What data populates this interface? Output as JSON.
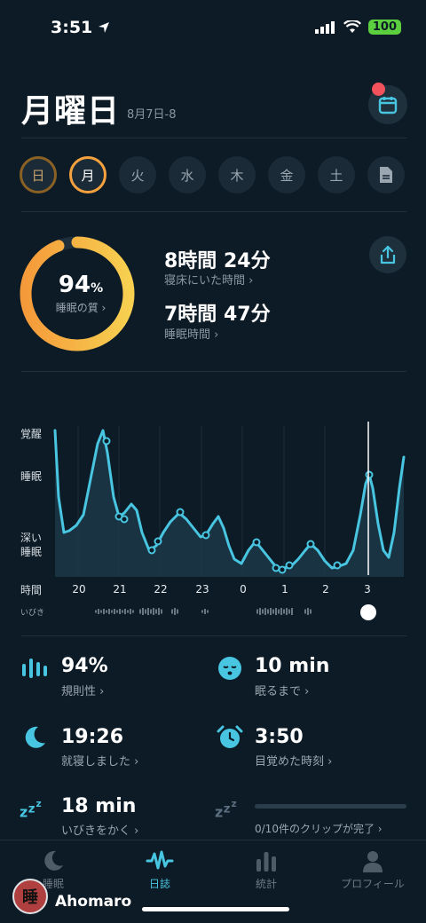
{
  "status": {
    "time": "3:51",
    "battery": "100"
  },
  "header": {
    "title": "月曜日",
    "date_range": "8月7日-8"
  },
  "week": {
    "days": [
      {
        "label": "日",
        "state": "past"
      },
      {
        "label": "月",
        "state": "active"
      },
      {
        "label": "火",
        "state": "none"
      },
      {
        "label": "水",
        "state": "none"
      },
      {
        "label": "木",
        "state": "none"
      },
      {
        "label": "金",
        "state": "none"
      },
      {
        "label": "土",
        "state": "none"
      }
    ]
  },
  "summary": {
    "quality_value": "94",
    "quality_unit": "%",
    "quality_label": "睡眠の質 ›",
    "quality_fraction": 0.94,
    "time_in_bed": "8時間 24分",
    "time_in_bed_label": "寝床にいた時間 ›",
    "sleep_time": "7時間 47分",
    "sleep_time_label": "睡眠時間 ›"
  },
  "chart_data": {
    "type": "line",
    "y_levels": [
      "覚醒",
      "睡眠",
      "深い\n睡眠"
    ],
    "ylabel": "",
    "xlabel": "時間",
    "x_ticks": [
      "20",
      "21",
      "22",
      "23",
      "0",
      "1",
      "2",
      "3"
    ],
    "snore_label": "いびき",
    "colors": {
      "line": "#48c5e0",
      "fill": "#1d3a4a"
    }
  },
  "stats": {
    "regularity_value": "94%",
    "regularity_label": "規則性 ›",
    "fall_asleep_value": "10 min",
    "fall_asleep_label": "眠るまで ›",
    "bedtime_value": "19:26",
    "bedtime_label": "就寝しました ›",
    "wake_value": "3:50",
    "wake_label": "目覚めた時刻 ›",
    "snore_value": "18 min",
    "snore_label": "いびきをかく ›",
    "clips_label": "0/10件のクリップが完了 ›"
  },
  "tabs": [
    {
      "label": "睡眠",
      "icon": "moon-icon"
    },
    {
      "label": "日誌",
      "icon": "wave-icon"
    },
    {
      "label": "統計",
      "icon": "bar-chart-icon"
    },
    {
      "label": "プロフィール",
      "icon": "person-icon"
    }
  ],
  "watermark": {
    "text": "Ahomaro",
    "seal_char": "睡"
  }
}
